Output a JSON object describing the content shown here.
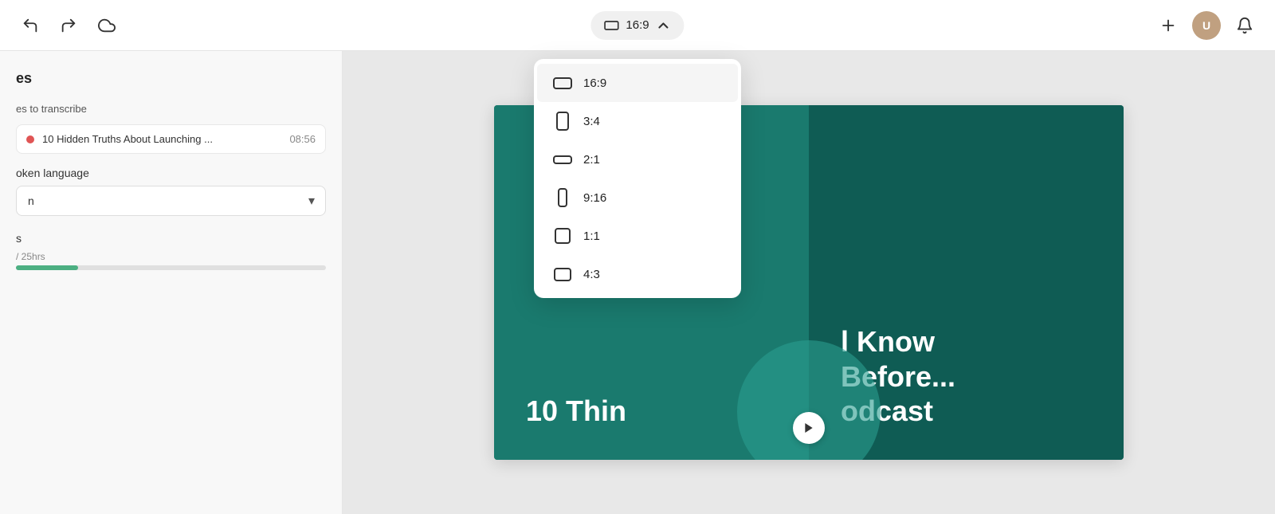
{
  "toolbar": {
    "undo_label": "Undo",
    "redo_label": "Redo",
    "cloud_label": "Cloud",
    "aspect_ratio_current": "16:9",
    "add_label": "+",
    "notification_label": "🔔"
  },
  "sidebar": {
    "section_title": "es",
    "files_label": "es to transcribe",
    "file_item": {
      "name": "10 Hidden Truths About Launching ...",
      "duration": "08:56"
    },
    "spoken_language_label": "oken language",
    "language_value": "n",
    "credits_label": "s",
    "credits_used": "/ 25hrs",
    "credits_bar_percent": 20
  },
  "dropdown": {
    "items": [
      {
        "id": "16-9",
        "label": "16:9",
        "icon": "landscape-icon",
        "active": true
      },
      {
        "id": "3-4",
        "label": "3:4",
        "icon": "portrait-icon",
        "active": false
      },
      {
        "id": "2-1",
        "label": "2:1",
        "icon": "landscape-wide-icon",
        "active": false
      },
      {
        "id": "9-16",
        "label": "9:16",
        "icon": "portrait-tall-icon",
        "active": false
      },
      {
        "id": "1-1",
        "label": "1:1",
        "icon": "square-icon",
        "active": false
      },
      {
        "id": "4-3",
        "label": "4:3",
        "icon": "landscape-std-icon",
        "active": false
      }
    ]
  },
  "slide": {
    "text_left": "10 Thin",
    "text_right": "l Know Before... odcast"
  }
}
